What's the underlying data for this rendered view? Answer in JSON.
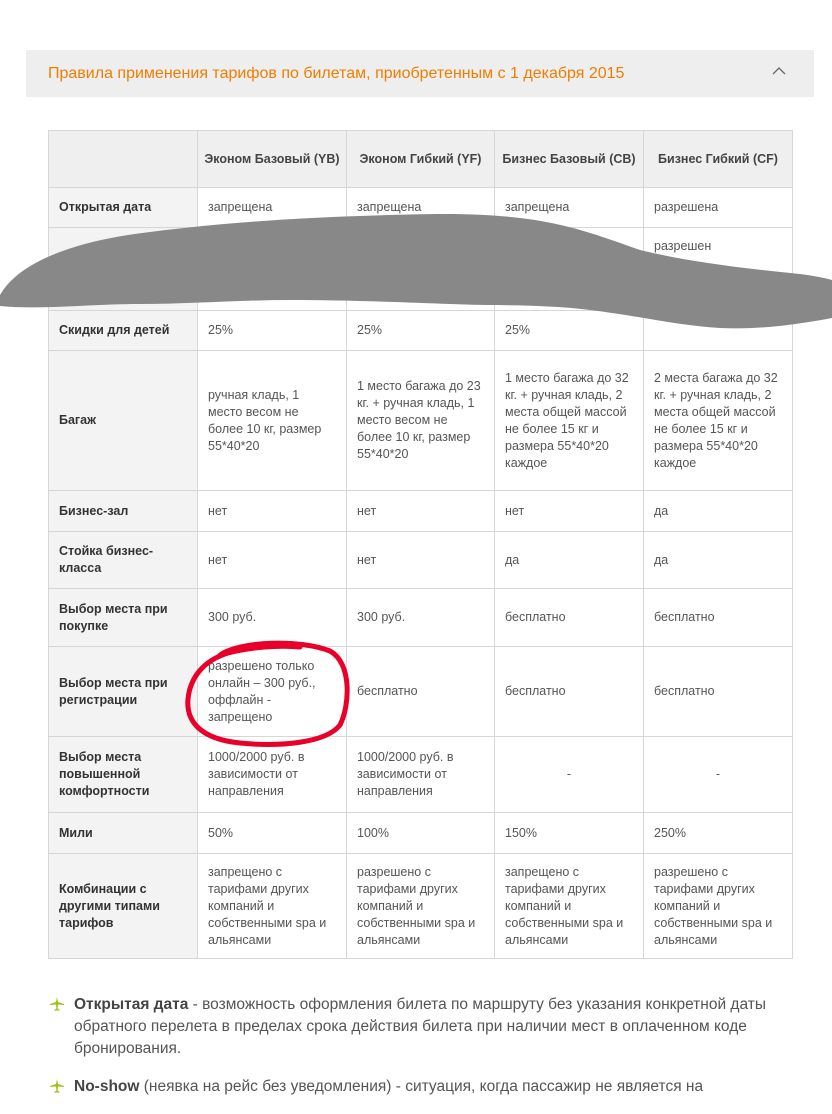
{
  "accordion": {
    "title": "Правила применения тарифов по билетам, приобретенным с 1 декабря 2015",
    "icon": "chevron-up-icon",
    "accent_color": "#f07d00"
  },
  "table": {
    "headers": [
      "",
      "Эконом Базовый (YB)",
      "Эконом Гибкий (YF)",
      "Бизнес Базовый (CB)",
      "Бизнес Гибкий (CF)"
    ],
    "rows": [
      {
        "label": "Открытая дата",
        "cells": [
          "запрещена",
          "запрещена",
          "запрещена",
          "разрешена"
        ]
      },
      {
        "label": "",
        "cells": [
          "",
          "",
          "",
          "разрешен"
        ]
      },
      {
        "label": "Скидки для детей",
        "cells": [
          "25%",
          "25%",
          "25%",
          ""
        ]
      },
      {
        "label": "Багаж",
        "cells": [
          "ручная кладь, 1 место весом не более 10 кг, размер 55*40*20",
          "1 место багажа до 23 кг. + ручная кладь, 1 место весом не более 10 кг, размер 55*40*20",
          "1 место багажа до 32 кг. + ручная кладь, 2 места общей массой не более 15 кг и размера 55*40*20 каждое",
          "2 места багажа до 32 кг. + ручная кладь, 2 места общей массой не более 15 кг и размера 55*40*20 каждое"
        ]
      },
      {
        "label": "Бизнес-зал",
        "cells": [
          "нет",
          "нет",
          "нет",
          "да"
        ]
      },
      {
        "label": "Стойка бизнес-класса",
        "cells": [
          "нет",
          "нет",
          "да",
          "да"
        ]
      },
      {
        "label": "Выбор места при покупке",
        "cells": [
          "300  руб.",
          "300  руб.",
          "бесплатно",
          "бесплатно"
        ]
      },
      {
        "label": "Выбор места при регистрации",
        "cells": [
          "разрешено только онлайн – 300 руб., оффлайн - запрещено",
          "бесплатно",
          "бесплатно",
          "бесплатно"
        ]
      },
      {
        "label": "Выбор места повышенной комфортности",
        "cells": [
          "1000/2000 руб. в зависимости от направления",
          "1000/2000 руб. в зависимости от направления",
          "-",
          "-"
        ]
      },
      {
        "label": "Мили",
        "cells": [
          "50%",
          "100%",
          "150%",
          "250%"
        ]
      },
      {
        "label": "Комбинации с другими типами тарифов",
        "cells": [
          "запрещено с тарифами  других компаний и собственными spa и альянсами",
          "разрешено с тарифами  других компаний и собственными spa и альянсами",
          "запрещено с тарифами  других компаний и собственными spa и альянсами",
          "разрешено с тарифами  других компаний и собственными spa и альянсами"
        ]
      }
    ]
  },
  "notes": [
    {
      "icon": "plane-icon",
      "term": "Открытая дата",
      "text": " - возможность оформления билета по маршруту без указания конкретной даты обратного перелета в пределах срока действия билета при наличии мест в оплаченном коде бронирования."
    },
    {
      "icon": "plane-icon",
      "term": "No-show",
      "text": " (неявка на рейс без уведомления) - ситуация, когда пассажир не является на"
    }
  ],
  "annotations": {
    "redaction_color": "#888888",
    "circle_color": "#e8002a"
  }
}
